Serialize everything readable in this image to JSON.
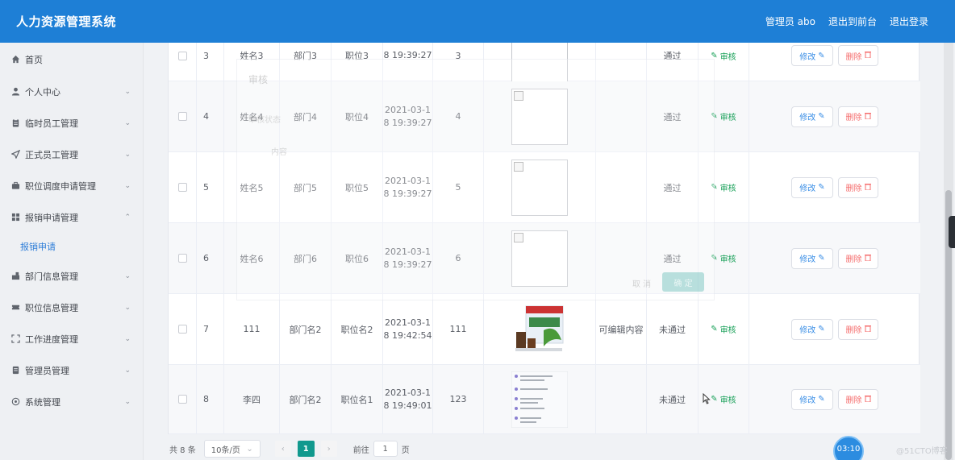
{
  "header": {
    "title": "人力资源管理系统",
    "admin": "管理员 abo",
    "back": "退出到前台",
    "logout": "退出登录"
  },
  "sidebar": {
    "items": [
      {
        "label": "首页",
        "icon": "home-icon"
      },
      {
        "label": "个人中心",
        "icon": "user-icon"
      },
      {
        "label": "临时员工管理",
        "icon": "clipboard-icon"
      },
      {
        "label": "正式员工管理",
        "icon": "send-icon"
      },
      {
        "label": "职位调度申请管理",
        "icon": "briefcase-icon"
      },
      {
        "label": "报销申请管理",
        "icon": "grid-icon"
      },
      {
        "label": "部门信息管理",
        "icon": "building-icon"
      },
      {
        "label": "职位信息管理",
        "icon": "ticket-icon"
      },
      {
        "label": "工作进度管理",
        "icon": "fullscreen-icon"
      },
      {
        "label": "管理员管理",
        "icon": "document-icon"
      },
      {
        "label": "系统管理",
        "icon": "settings-icon"
      }
    ],
    "submenu": {
      "label": "报销申请"
    }
  },
  "table": {
    "audit_label": "审核",
    "edit_label": "修改",
    "delete_label": "删除",
    "rows": [
      {
        "index": "3",
        "name": "姓名3",
        "dept": "部门3",
        "position": "职位3",
        "time_line1": "",
        "time_line2": "8 19:39:27",
        "amount": "3",
        "image": "broken",
        "remark": "",
        "status": "通过"
      },
      {
        "index": "4",
        "name": "姓名4",
        "dept": "部门4",
        "position": "职位4",
        "time_line1": "2021-03-1",
        "time_line2": "8 19:39:27",
        "amount": "4",
        "image": "broken",
        "remark": "",
        "status": "通过"
      },
      {
        "index": "5",
        "name": "姓名5",
        "dept": "部门5",
        "position": "职位5",
        "time_line1": "2021-03-1",
        "time_line2": "8 19:39:27",
        "amount": "5",
        "image": "broken",
        "remark": "",
        "status": "通过"
      },
      {
        "index": "6",
        "name": "姓名6",
        "dept": "部门6",
        "position": "职位6",
        "time_line1": "2021-03-1",
        "time_line2": "8 19:39:27",
        "amount": "6",
        "image": "broken",
        "remark": "",
        "status": "通过"
      },
      {
        "index": "7",
        "name": "111",
        "dept": "部门名2",
        "position": "职位名2",
        "time_line1": "2021-03-1",
        "time_line2": "8 19:42:54",
        "amount": "111",
        "image": "product",
        "remark": "可编辑内容",
        "status": "未通过"
      },
      {
        "index": "8",
        "name": "李四",
        "dept": "部门名2",
        "position": "职位名1",
        "time_line1": "2021-03-1",
        "time_line2": "8 19:49:01",
        "amount": "123",
        "image": "document",
        "remark": "",
        "status": "未通过"
      }
    ]
  },
  "pagination": {
    "total": "共 8 条",
    "page_size": "10条/页",
    "current_page": "1",
    "goto_label": "前往",
    "goto_value": "1",
    "page_suffix": "页"
  },
  "dialog": {
    "title": "审核",
    "label_status": "审核状态",
    "label_reply": "内容",
    "cancel": "取 消",
    "confirm": "确 定"
  },
  "timer": "03:10",
  "watermark": "@51CTO博客",
  "colors": {
    "header_bg": "#1e7fd6",
    "accent": "#11998e",
    "link": "#2f7ed8",
    "audit": "#18a058",
    "danger": "#f56c6c"
  }
}
